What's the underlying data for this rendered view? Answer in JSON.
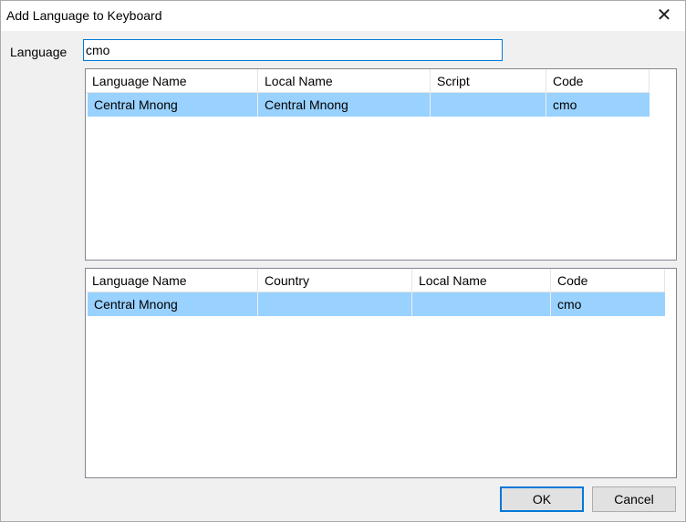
{
  "window": {
    "title": "Add Language to Keyboard",
    "close_glyph": "✕"
  },
  "language": {
    "label": "Language",
    "value": "cmo"
  },
  "list1": {
    "columns": [
      "Language Name",
      "Local Name",
      "Script",
      "Code"
    ],
    "rows": [
      [
        "Central Mnong",
        "Central Mnong",
        "",
        "cmo"
      ]
    ]
  },
  "list2": {
    "columns": [
      "Language Name",
      "Country",
      "Local Name",
      "Code"
    ],
    "rows": [
      [
        "Central Mnong",
        "",
        "",
        "cmo"
      ]
    ]
  },
  "buttons": {
    "ok": "OK",
    "cancel": "Cancel"
  },
  "colors": {
    "selection": "#99d1ff",
    "focus_border": "#0078d7"
  }
}
